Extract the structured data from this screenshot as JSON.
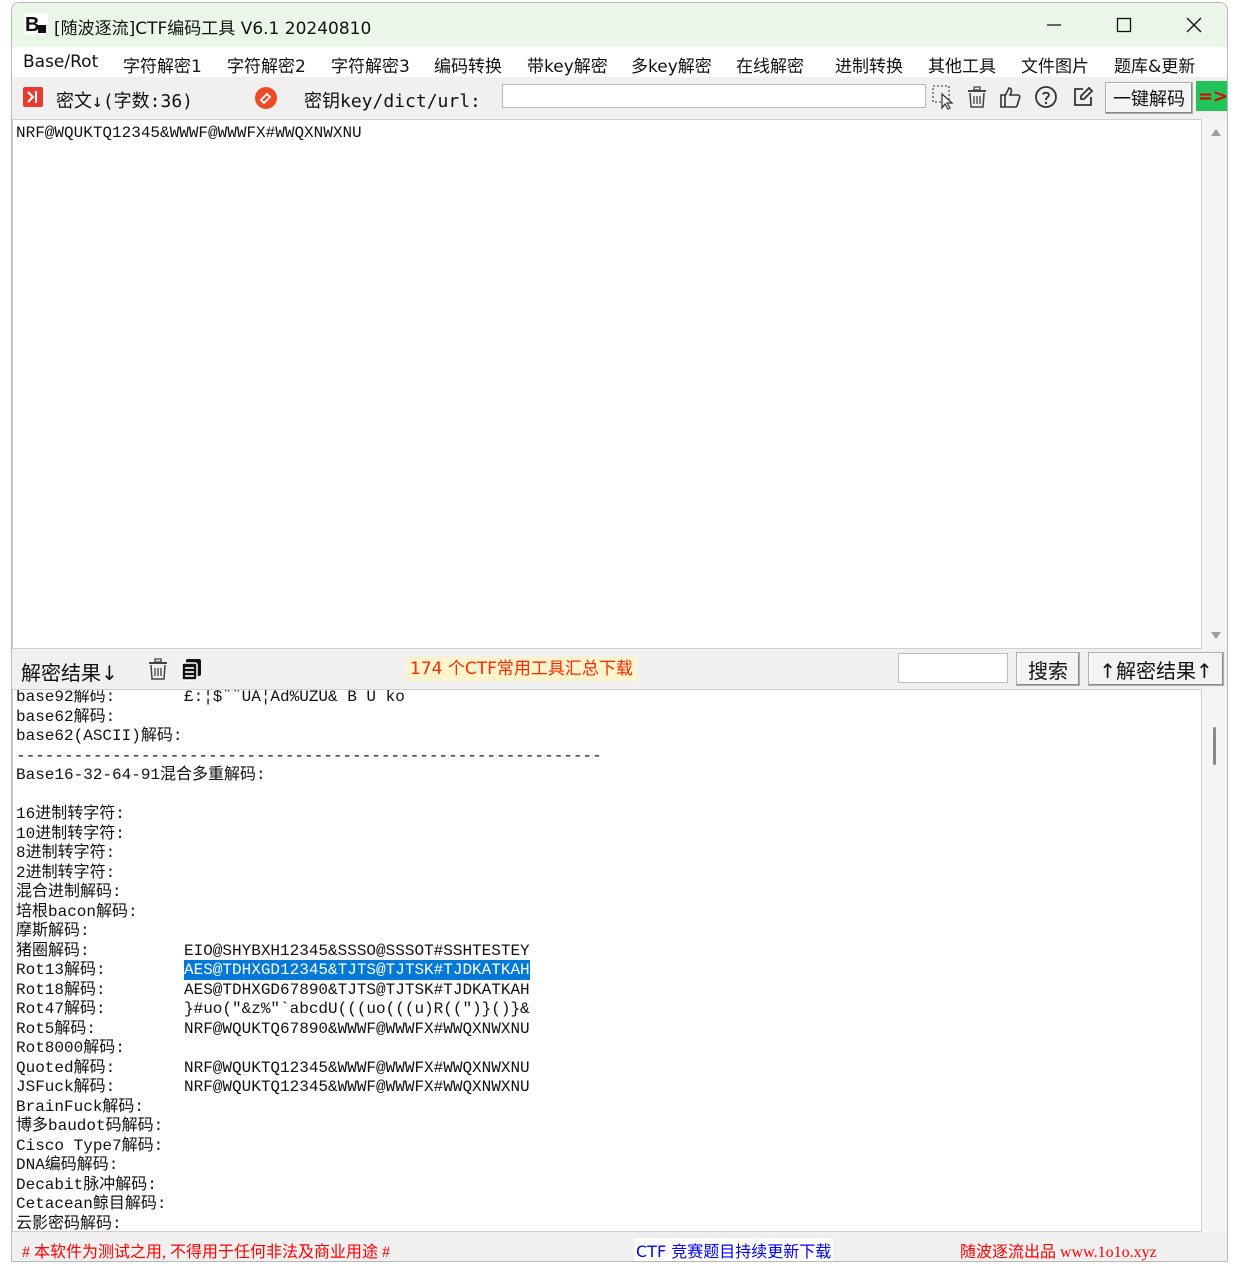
{
  "window": {
    "title": "[随波逐流]CTF编码工具 V6.1 20240810",
    "app_icon_text": "B"
  },
  "menu": [
    "Base/Rot",
    "字符解密1",
    "字符解密2",
    "字符解密3",
    "编码转换",
    "带key解密",
    "多key解密",
    "在线解密",
    "进制转换",
    "其他工具",
    "文件图片",
    "题库&更新"
  ],
  "toolbar": {
    "cipher_label": "密文↓(字数:36)",
    "key_label": "密钥key/dict/url:",
    "key_value": "",
    "decode_button": "一键解码",
    "arrow": "=>"
  },
  "input_text": "NRF@WQUKTQ12345&WWWF@WWWFX#WWQXNWXNU",
  "mid": {
    "result_label": "解密结果↓",
    "promo": "174 个CTF常用工具汇总下载",
    "search_value": "",
    "search_button": "搜索",
    "result_up_button": "↑解密结果↑"
  },
  "results": [
    {
      "label": "base92解码:",
      "value": "£:¦$¨¨UA¦Ad%UZU& B U ko"
    },
    {
      "label": "base62解码:",
      "value": ""
    },
    {
      "label": "base62(ASCII)解码:",
      "value": ""
    },
    {
      "label": "-------------------------------------------------------------",
      "value": ""
    },
    {
      "label": "Base16-32-64-91混合多重解码:",
      "value": ""
    },
    {
      "label": "",
      "value": ""
    },
    {
      "label": "16进制转字符:",
      "value": ""
    },
    {
      "label": "10进制转字符:",
      "value": ""
    },
    {
      "label": "8进制转字符:",
      "value": ""
    },
    {
      "label": "2进制转字符:",
      "value": ""
    },
    {
      "label": "混合进制解码:",
      "value": ""
    },
    {
      "label": "培根bacon解码:",
      "value": ""
    },
    {
      "label": "摩斯解码:",
      "value": ""
    },
    {
      "label": "猪圈解码:",
      "value": "EIO@SHYBXH12345&SSSO@SSSOT#SSHTESTEY"
    },
    {
      "label": "Rot13解码:",
      "value": "AES@TDHXGD12345&TJTS@TJTSK#TJDKATKAH"
    },
    {
      "label": "Rot18解码:",
      "value": "AES@TDHXGD67890&TJTS@TJTSK#TJDKATKAH"
    },
    {
      "label": "Rot47解码:",
      "value": "}#uo(\"&z%\"`abcdU(((uo(((u)R((\")}()}&"
    },
    {
      "label": "Rot5解码:",
      "value": "NRF@WQUKTQ67890&WWWF@WWWFX#WWQXNWXNU"
    },
    {
      "label": "Rot8000解码:",
      "value": ""
    },
    {
      "label": "Quoted解码:",
      "value": "NRF@WQUKTQ12345&WWWF@WWWFX#WWQXNWXNU"
    },
    {
      "label": "JSFuck解码:",
      "value": "NRF@WQUKTQ12345&WWWF@WWWFX#WWQXNWXNU"
    },
    {
      "label": "BrainFuck解码:",
      "value": ""
    },
    {
      "label": "博多baudot码解码:",
      "value": ""
    },
    {
      "label": "Cisco Type7解码:",
      "value": ""
    },
    {
      "label": "DNA编码解码:",
      "value": ""
    },
    {
      "label": "Decabit脉冲解码:",
      "value": ""
    },
    {
      "label": "Cetacean鲸目解码:",
      "value": ""
    },
    {
      "label": "云影密码解码:",
      "value": ""
    }
  ],
  "status": {
    "left": "# 本软件为测试之用, 不得用于任何非法及商业用途 #",
    "center": "CTF 竞赛题目持续更新下载",
    "right": "随波逐流出品 www.1o1o.xyz"
  },
  "colors": {
    "title_bg": "#eaf6e8",
    "selection": "#0078d7",
    "promo_text": "#ff2a00",
    "status_left": "#ff0000",
    "status_center": "#0000ff",
    "arrow_bg": "#22c35a"
  }
}
